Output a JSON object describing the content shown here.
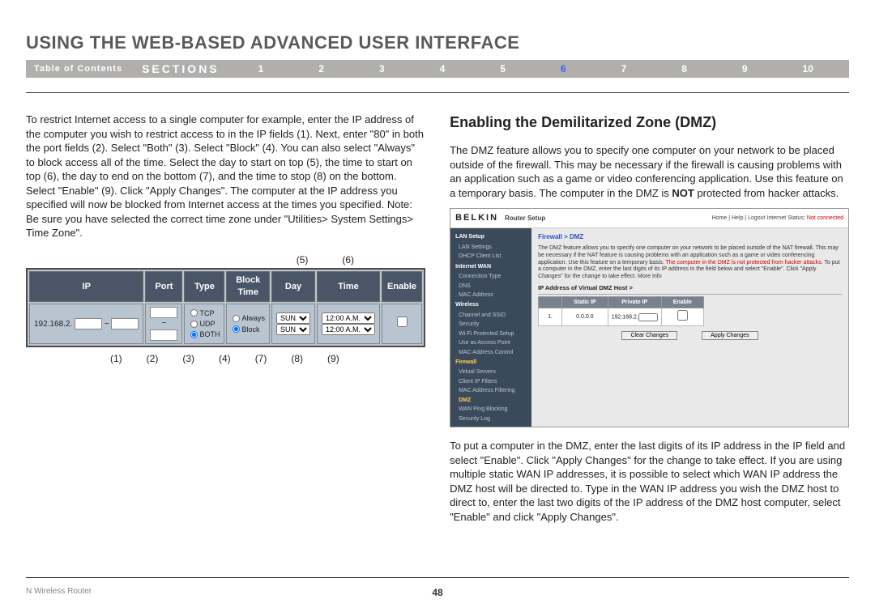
{
  "page": {
    "title": "USING THE WEB-BASED ADVANCED USER INTERFACE",
    "toc": "Table of Contents",
    "sections_label": "SECTIONS",
    "nav_nums": [
      "1",
      "2",
      "3",
      "4",
      "5",
      "6",
      "7",
      "8",
      "9",
      "10"
    ],
    "current_section": "6",
    "footer_left": "N Wireless Router",
    "page_number": "48"
  },
  "left": {
    "para": "To restrict Internet access to a single computer for example, enter the IP address of the computer you wish to restrict access to in the IP fields (1). Next, enter \"80\" in both the port fields (2). Select \"Both\" (3). Select \"Block\" (4). You can also select \"Always\" to block access all of the time. Select the day to start on top (5), the time to start on top (6), the day to end on the bottom (7), and the time to stop (8) on the bottom. Select \"Enable\" (9). Click \"Apply Changes\". The computer at the IP address you specified will now be blocked from Internet access at the times you specified. Note: Be sure you have selected the correct time zone under \"Utilities> System Settings> Time Zone\".",
    "callouts_top": [
      "(5)",
      "(6)"
    ],
    "callouts_bot": [
      "(1)",
      "(2)",
      "(3)",
      "(4)",
      "(7)",
      "(8)",
      "(9)"
    ],
    "tbl": {
      "headers": [
        "IP",
        "Port",
        "Type",
        "Block Time",
        "Day",
        "Time",
        "Enable"
      ],
      "ip_prefix": "192.168.2.",
      "type_opts": [
        "TCP",
        "UDP",
        "BOTH"
      ],
      "type_sel": "BOTH",
      "block_opts": [
        "Always",
        "Block"
      ],
      "block_sel": "Block",
      "day_top": "SUN",
      "day_bot": "SUN",
      "time_top": "12:00 A.M.",
      "time_bot": "12:00 A.M."
    }
  },
  "right": {
    "heading": "Enabling the Demilitarized Zone (DMZ)",
    "para1_a": "The DMZ feature allows you to specify one computer on your network to be placed outside of the firewall. This may be necessary if the firewall is causing problems with an application such as a game or video conferencing application. Use this feature on a temporary basis. The computer in the DMZ is ",
    "para1_not": "NOT",
    "para1_b": " protected from hacker attacks.",
    "para2": "To put a computer in the DMZ, enter the last digits of its IP address in the IP field and select \"Enable\". Click \"Apply Changes\" for the change to take effect. If you are using multiple static WAN IP addresses, it is possible to select which WAN IP address the DMZ host will be directed to. Type in the WAN IP address you wish the DMZ host to direct to, enter the last two digits of the IP address of the DMZ host computer, select \"Enable\" and click \"Apply Changes\".",
    "shot": {
      "brand": "BELKIN",
      "brand_sub": "Router Setup",
      "topright_links": "Home | Help | Logout   Internet Status: ",
      "topright_status": "Not connected",
      "nav": {
        "g1": "LAN Setup",
        "g1a": "LAN Settings",
        "g1b": "DHCP Client List",
        "g2": "Internet WAN",
        "g2a": "Connection Type",
        "g2b": "DNS",
        "g2c": "MAC Address",
        "g3": "Wireless",
        "g3a": "Channel and SSID",
        "g3b": "Security",
        "g3c": "Wi-Fi Protected Setup",
        "g3d": "Use as Access Point",
        "g3e": "MAC Address Control",
        "g4": "Firewall",
        "g4a": "Virtual Servers",
        "g4b": "Client IP Filters",
        "g4c": "MAC Address Filtering",
        "g4d": "DMZ",
        "g4e": "WAN Ping Blocking",
        "g4f": "Security Log"
      },
      "crumb": "Firewall > DMZ",
      "desc_a": "The DMZ feature allows you to specify one computer on your network to be placed outside of the NAT firewall. This may be necessary if the NAT feature is causing problems with an application such as a game or video conferencing application. Use this feature on a temporary basis. ",
      "desc_warn": "The computer in the DMZ is not protected from hacker attacks.",
      "desc_b": " To put a computer in the DMZ, enter the last digits of its IP address in the field below and select \"Enable\". Click \"Apply Changes\" for the change to take effect. More Info",
      "section_label": "IP Address of Virtual DMZ Host >",
      "tbl_headers": [
        "",
        "Static IP",
        "Private IP",
        "Enable"
      ],
      "row_num": "1.",
      "static_ip": "0.0.0.0",
      "private_ip_prefix": "192.168.2.",
      "btn_clear": "Clear Changes",
      "btn_apply": "Apply Changes"
    }
  }
}
